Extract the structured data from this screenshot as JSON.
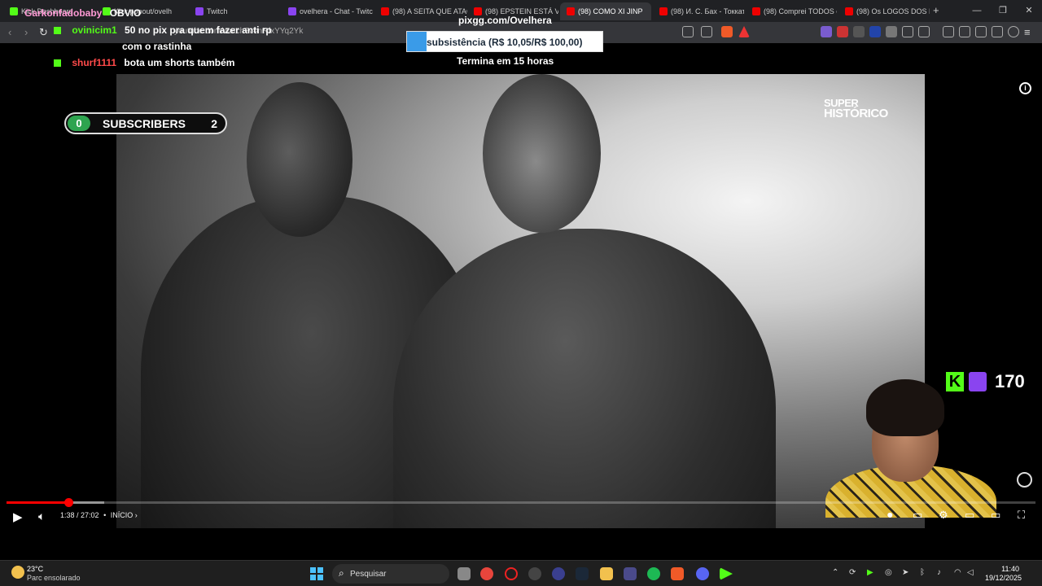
{
  "browser": {
    "tabs": [
      {
        "label": "Kick Dashboard",
        "icon": "kick-icon",
        "active": false
      },
      {
        "label": "Kick popout/ovelh",
        "icon": "kick-icon",
        "active": false
      },
      {
        "label": "Twitch",
        "icon": "twitch-icon",
        "active": false
      },
      {
        "label": "ovelhera - Chat - Twitc",
        "icon": "twitch-icon",
        "active": false
      },
      {
        "label": "(98) A SEITA QUE ATAC",
        "icon": "youtube-icon",
        "active": false
      },
      {
        "label": "(98) EPSTEIN ESTÁ VIVO",
        "icon": "youtube-icon",
        "active": false
      },
      {
        "label": "(98) COMO XI JINP",
        "icon": "youtube-icon",
        "active": true
      },
      {
        "label": "(98) И. С. Бах - Токкат",
        "icon": "youtube-icon",
        "active": false
      },
      {
        "label": "(98) Comprei TODOS o",
        "icon": "youtube-icon",
        "active": false
      },
      {
        "label": "(98) Os LOGOS DOS PI",
        "icon": "youtube-icon",
        "active": false
      }
    ],
    "url": "youtube.com/watch?v=nRfxYYq2Yk"
  },
  "chat": [
    {
      "user": "Garkonfadobaby",
      "user_color": "#ff9ad5",
      "message": "OBVIO"
    },
    {
      "user": "ovinicim1",
      "user_color": "#53fc18",
      "message": "50 no pix pra quem fazer anti rp"
    },
    {
      "user": "",
      "user_color": "#ffffff",
      "message": "com o rastinha"
    },
    {
      "user": "shurf1111",
      "user_color": "#ff4a4a",
      "message": "bota um shorts também"
    }
  ],
  "goal": {
    "site": "pixgg.com/Ovelhera",
    "text": "subsistência (R$ 10,05/R$ 100,00)",
    "progress_fraction": 0.1005,
    "ends": "Termina em 15 horas"
  },
  "subscribers": {
    "left": "0",
    "label": "SUBSCRIBERS",
    "right": "2"
  },
  "viewers": {
    "count": "170"
  },
  "video": {
    "watermark_line1": "SUPER",
    "watermark_line2": "HISTÓRICO",
    "timecode": "1:38 / 27:02",
    "chapter": "INÍCIO",
    "played_fraction": 0.0604,
    "buffered_fraction": 0.095
  },
  "taskbar": {
    "temperature": "23°C",
    "weather": "Parc ensolarado",
    "search_placeholder": "Pesquisar",
    "time": "11:40",
    "date": "19/12/2025"
  },
  "colors": {
    "accent_red": "#ff0000",
    "kick_green": "#53fc18",
    "twitch_purple": "#8a44f0",
    "goal_blue": "#3a9be8"
  }
}
